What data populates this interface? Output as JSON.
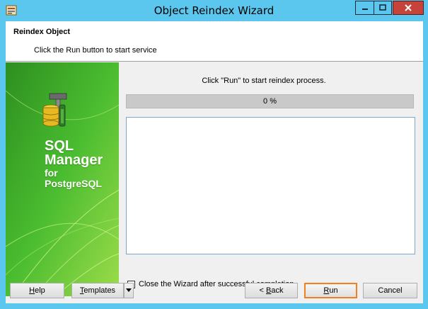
{
  "window": {
    "title": "Object Reindex Wizard"
  },
  "header": {
    "title": "Reindex Object",
    "subtitle": "Click the Run button to start service"
  },
  "side": {
    "line1": "SQL",
    "line2": "Manager",
    "line3": "for",
    "line4": "PostgreSQL"
  },
  "main": {
    "status": "Click \"Run\" to start reindex process.",
    "progress_label": "0 %",
    "progress_value": 0,
    "close_checkbox_label": "Close the Wizard after successful completion",
    "close_checkbox_checked": false
  },
  "buttons": {
    "help": {
      "pre": "",
      "u": "H",
      "post": "elp"
    },
    "templates": {
      "pre": "",
      "u": "T",
      "post": "emplates"
    },
    "back": {
      "pre": "< ",
      "u": "B",
      "post": "ack"
    },
    "run": {
      "pre": "",
      "u": "R",
      "post": "un"
    },
    "cancel": "Cancel"
  },
  "colors": {
    "title_bar": "#5cc7ee",
    "close_button": "#c7433a",
    "side_panel_green": "#3fae2a",
    "default_button_border": "#f08020"
  },
  "icons": {
    "title": "wizard-app-icon",
    "side": "database-tools-icon",
    "minimize": "minimize-icon",
    "maximize": "maximize-icon",
    "close": "close-icon",
    "dropdown": "triangle-down-icon"
  }
}
